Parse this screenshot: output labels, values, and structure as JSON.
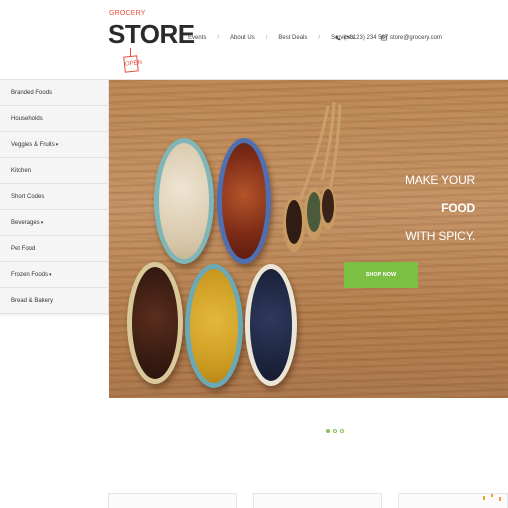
{
  "logo": {
    "small": "GROCERY",
    "big": "STORE",
    "tag": "OPEN"
  },
  "nav": {
    "items": [
      "Events",
      "About Us",
      "Best Deals",
      "Services"
    ],
    "separator": "/"
  },
  "contact": {
    "phone": "(+0123) 234 567",
    "email": "store@grocery.com",
    "phone_icon": "phone-icon",
    "mail_icon": "mail-icon"
  },
  "sidebar": {
    "items": [
      {
        "label": "Branded Foods",
        "arrow": ""
      },
      {
        "label": "Households",
        "arrow": ""
      },
      {
        "label": "Veggies & Fruits",
        "arrow": "▾"
      },
      {
        "label": "Kitchen",
        "arrow": ""
      },
      {
        "label": "Short Codes",
        "arrow": ""
      },
      {
        "label": "Beverages",
        "arrow": "▾"
      },
      {
        "label": "Pet Food",
        "arrow": ""
      },
      {
        "label": "Frozen Foods",
        "arrow": "▾"
      },
      {
        "label": "Bread & Bakery",
        "arrow": ""
      }
    ]
  },
  "hero": {
    "line1": "MAKE YOUR",
    "line2": "FOOD",
    "line3": "WITH SPICY.",
    "button": "SHOP NOW"
  },
  "colors": {
    "accent": "#7bc043",
    "brand_red": "#e74c3c"
  },
  "slider": {
    "active_index": 0,
    "count": 3
  }
}
